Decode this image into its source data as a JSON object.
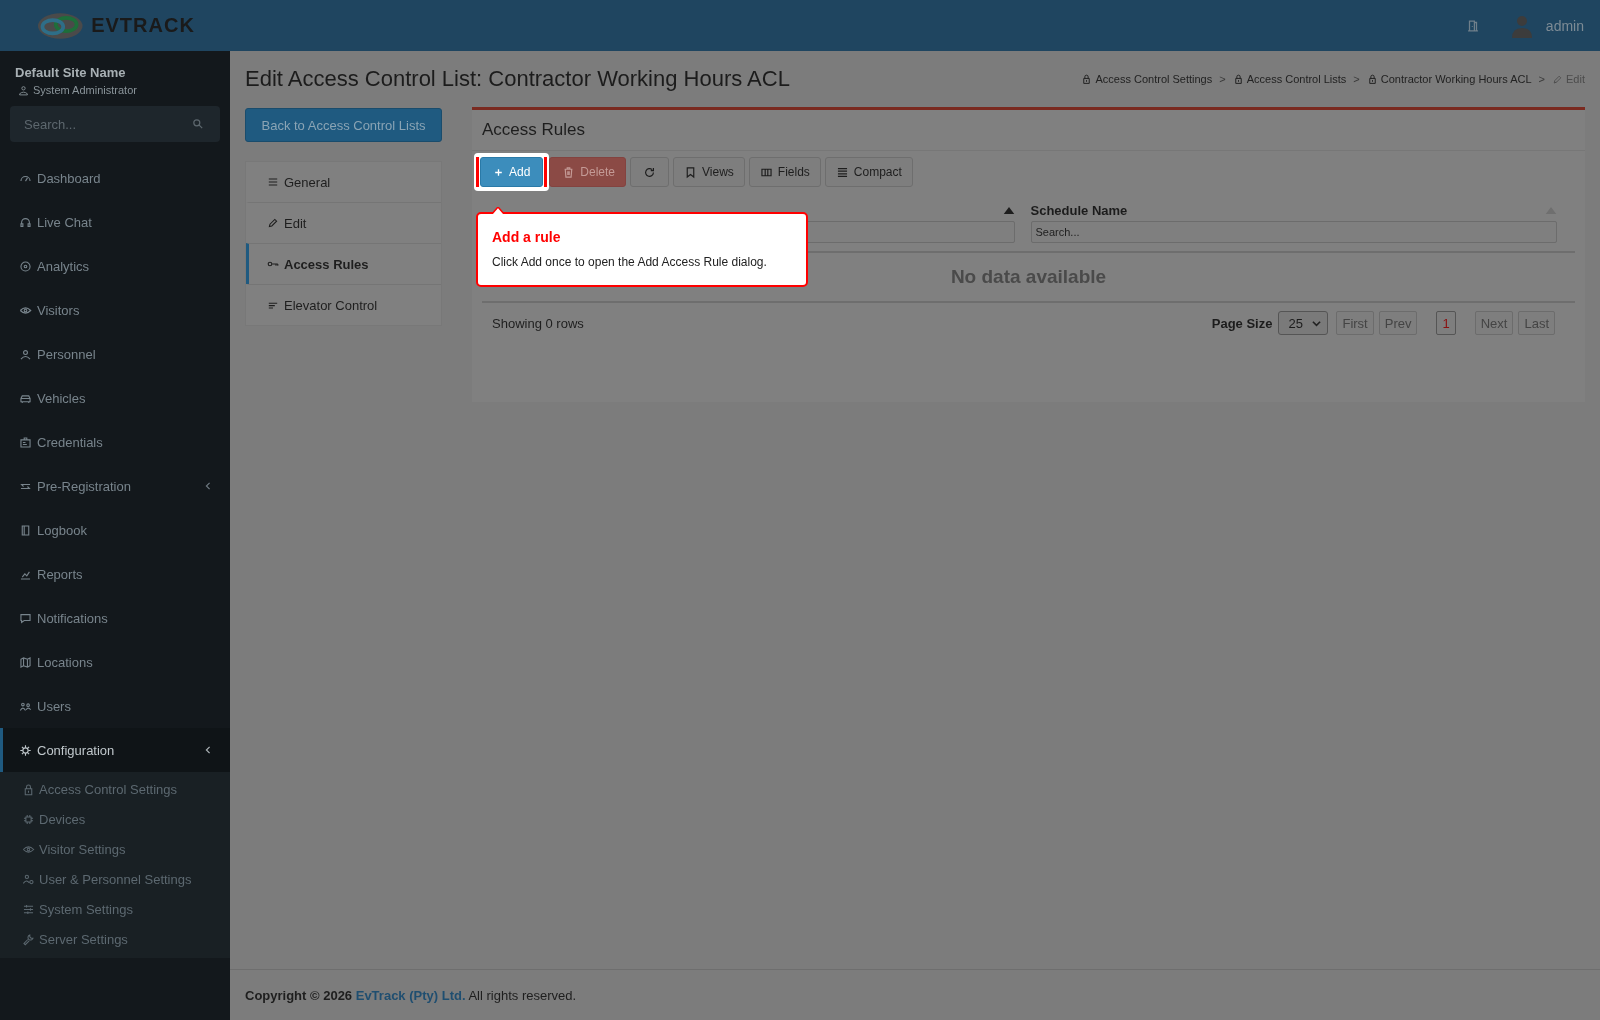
{
  "header": {
    "logo_text": "EVTRACK",
    "user": "admin"
  },
  "sidebar": {
    "site_name": "Default Site Name",
    "role": "System Administrator",
    "search": {
      "placeholder": "Search..."
    },
    "items": [
      {
        "label": "Dashboard",
        "selected": false
      },
      {
        "label": "Live Chat",
        "selected": false
      },
      {
        "label": "Analytics",
        "selected": false
      },
      {
        "label": "Visitors",
        "selected": false
      },
      {
        "label": "Personnel",
        "selected": false
      },
      {
        "label": "Vehicles",
        "selected": false
      },
      {
        "label": "Credentials",
        "selected": false
      },
      {
        "label": "Pre-Registration",
        "selected": false,
        "expanded": false
      },
      {
        "label": "Logbook",
        "selected": false
      },
      {
        "label": "Reports",
        "selected": false
      },
      {
        "label": "Notifications",
        "selected": false
      },
      {
        "label": "Locations",
        "selected": false
      },
      {
        "label": "Users",
        "selected": false
      },
      {
        "label": "Configuration",
        "selected": true,
        "expanded": true,
        "children": [
          {
            "label": "Access Control Settings"
          },
          {
            "label": "Devices"
          },
          {
            "label": "Visitor Settings"
          },
          {
            "label": "User & Personnel Settings"
          },
          {
            "label": "System Settings"
          },
          {
            "label": "Server Settings"
          }
        ]
      }
    ]
  },
  "page": {
    "title": "Edit Access Control List: Contractor Working Hours ACL",
    "breadcrumbs": [
      {
        "label": "Access Control Settings",
        "kind": "link"
      },
      {
        "label": "Access Control Lists",
        "kind": "link",
        "separator": ">"
      },
      {
        "label": "Contractor Working Hours ACL",
        "kind": "link",
        "separator": ">"
      },
      {
        "label": "Edit",
        "kind": "current",
        "separator": ">"
      }
    ],
    "back_button": "Back to Access Control Lists",
    "tabs": [
      {
        "label": "General",
        "selected": false
      },
      {
        "label": "Edit",
        "selected": false
      },
      {
        "label": "Access Rules",
        "selected": true
      },
      {
        "label": "Elevator Control",
        "selected": false
      }
    ]
  },
  "panel": {
    "title": "Access Rules",
    "toolbar": [
      {
        "kind": "add",
        "label": "Add",
        "disabled": false
      },
      {
        "kind": "delete",
        "label": "Delete",
        "disabled": true
      },
      {
        "kind": "refresh",
        "disabled": false
      },
      {
        "kind": "views",
        "label": "Views",
        "disabled": false
      },
      {
        "kind": "fields",
        "label": "Fields",
        "disabled": false
      },
      {
        "kind": "compact",
        "label": "Compact",
        "disabled": false
      }
    ],
    "table": {
      "columns": [
        {
          "sorted": true
        },
        {
          "label": "Schedule Name",
          "sorted": false,
          "placeholder": "Search..."
        }
      ],
      "empty_text": "No data available"
    },
    "footer": {
      "row_count": "Showing 0 rows",
      "page_size_label": "Page Size",
      "page_size": "25",
      "pages": [
        {
          "label": "First",
          "disabled": true,
          "selected": false
        },
        {
          "label": "Prev",
          "disabled": true,
          "selected": false
        },
        {
          "label": "1",
          "disabled": false,
          "selected": true
        },
        {
          "label": "Next",
          "disabled": true,
          "selected": false
        },
        {
          "label": "Last",
          "disabled": true,
          "selected": false
        }
      ]
    }
  },
  "tour": {
    "title": "Add a rule",
    "text": "Click Add once to open the Add Access Rule dialog."
  },
  "footer": {
    "prefix": "Copyright © 2026",
    "link": "EvTrack (Pty) Ltd.",
    "suffix": "All rights reserved."
  }
}
